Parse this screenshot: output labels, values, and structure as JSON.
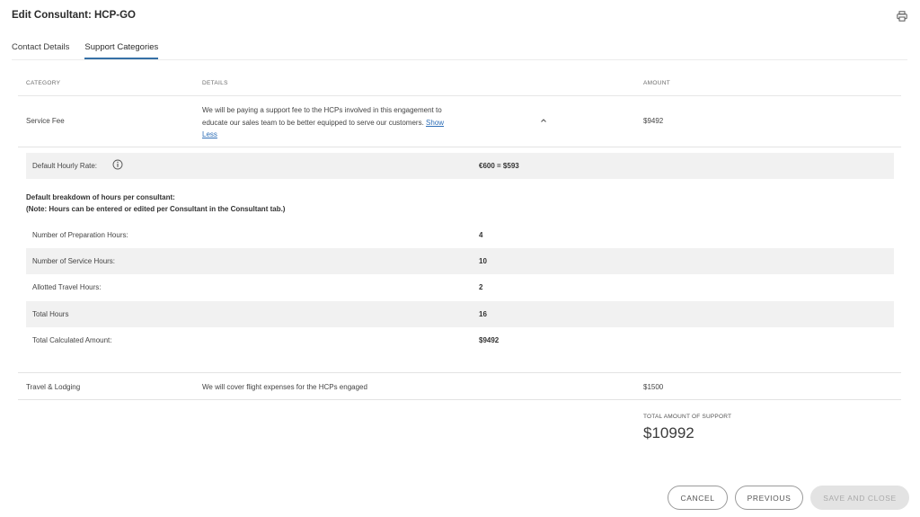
{
  "header": {
    "title": "Edit Consultant: HCP-GO"
  },
  "tabs": [
    {
      "label": "Contact Details",
      "active": false
    },
    {
      "label": "Support Categories",
      "active": true
    }
  ],
  "table": {
    "columns": {
      "category": "CATEGORY",
      "details": "DETAILS",
      "amount": "AMOUNT"
    }
  },
  "service_fee": {
    "category": "Service Fee",
    "details": "We will be paying a support fee to the HCPs involved in this engagement to educate our sales team to be better equipped to serve our customers.",
    "show_less": "Show Less",
    "amount": "$9492",
    "expanded": true
  },
  "rate": {
    "label": "Default Hourly Rate:",
    "value": "€600 = $593"
  },
  "breakdown": {
    "title": "Default breakdown of hours per consultant:",
    "note": "(Note: Hours can be entered or edited per Consultant in the Consultant tab.)",
    "rows": [
      {
        "label": "Number of Preparation Hours:",
        "value": "4",
        "shaded": false
      },
      {
        "label": "Number of Service Hours:",
        "value": "10",
        "shaded": true
      },
      {
        "label": "Allotted Travel Hours:",
        "value": "2",
        "shaded": false
      },
      {
        "label": "Total Hours",
        "value": "16",
        "shaded": true
      },
      {
        "label": "Total Calculated Amount:",
        "value": "$9492",
        "shaded": false
      }
    ]
  },
  "travel": {
    "category": "Travel & Lodging",
    "details": "We will cover flight expenses for the HCPs engaged",
    "amount": "$1500"
  },
  "total": {
    "label": "TOTAL AMOUNT OF SUPPORT",
    "value": "$10992"
  },
  "buttons": {
    "cancel": "CANCEL",
    "previous": "PREVIOUS",
    "save": "SAVE AND CLOSE"
  },
  "colors": {
    "accent": "#3670a6",
    "link": "#2f6fb7",
    "shade": "#f1f1f1",
    "disabled_bg": "#e3e3e3"
  }
}
